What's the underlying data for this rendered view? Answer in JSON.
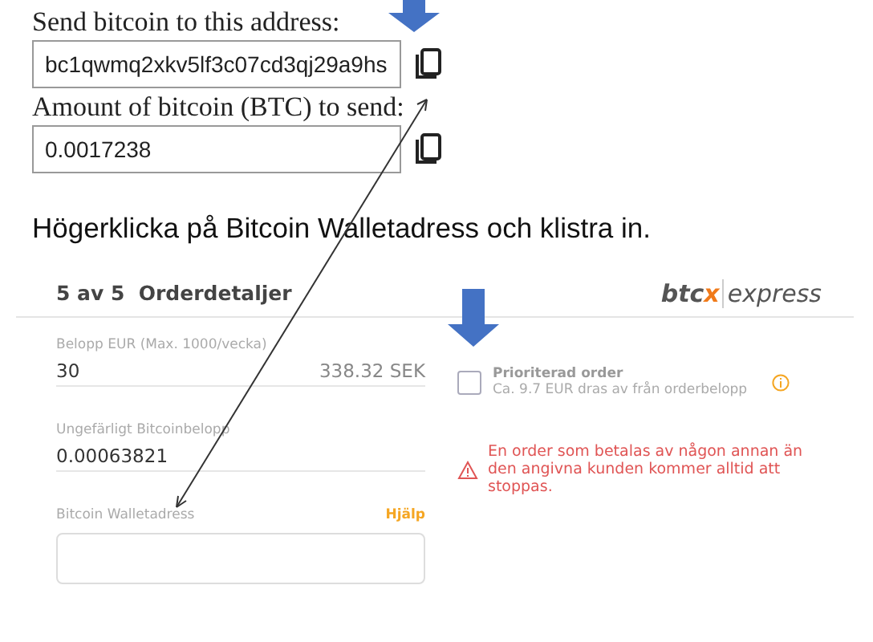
{
  "payment": {
    "address_label": "Send bitcoin to this address:",
    "address_value": "bc1qwmq2xkv5lf3c07cd3qj29a9hs",
    "amount_label": "Amount of bitcoin (BTC) to send:",
    "amount_value": "0.0017238"
  },
  "instruction": "Högerklicka på Bitcoin Walletadress och klistra in.",
  "order": {
    "step": "5 av 5",
    "title": "Orderdetaljer",
    "logo": {
      "brand": "btc",
      "accent": "x",
      "product": "express"
    },
    "amount_label": "Belopp EUR (Max. 1000/vecka)",
    "amount_value": "30",
    "amount_converted": "338.32 SEK",
    "btc_label": "Ungefärligt Bitcoinbelopp",
    "btc_value": "0.00063821",
    "wallet_label": "Bitcoin Walletadress",
    "help_link": "Hjälp",
    "priority": {
      "label": "Prioriterad order",
      "note": "Ca. 9.7 EUR dras av från orderbelopp",
      "checked": false
    },
    "warning": "En order som betalas av någon annan än den angivna kunden kommer alltid att stoppas."
  }
}
